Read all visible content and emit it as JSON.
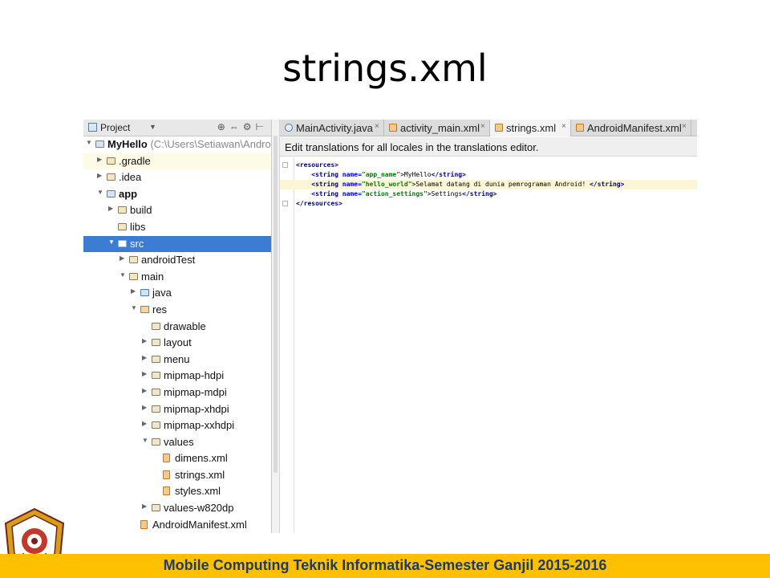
{
  "slide": {
    "title": "strings.xml",
    "footer": "Mobile Computing Teknik Informatika-Semester Ganjil 2015-2016"
  },
  "project_panel": {
    "header_label": "Project",
    "tree": [
      {
        "label": "MyHello",
        "path": " (C:\\Users\\Setiawan\\Android",
        "bold": true,
        "indent": 0,
        "arrow": "down",
        "icon": "module",
        "highlight": "none"
      },
      {
        "label": ".gradle",
        "indent": 1,
        "arrow": "right",
        "icon": "folder",
        "highlight": "yellow"
      },
      {
        "label": ".idea",
        "indent": 1,
        "arrow": "right",
        "icon": "folder",
        "highlight": "none"
      },
      {
        "label": "app",
        "bold": true,
        "indent": 1,
        "arrow": "down",
        "icon": "module",
        "highlight": "none"
      },
      {
        "label": "build",
        "indent": 2,
        "arrow": "right",
        "icon": "folder",
        "highlight": "none"
      },
      {
        "label": "libs",
        "indent": 2,
        "arrow": "none",
        "icon": "folder",
        "highlight": "none"
      },
      {
        "label": "src",
        "indent": 2,
        "arrow": "down",
        "icon": "src-folder",
        "highlight": "selected"
      },
      {
        "label": "androidTest",
        "indent": 3,
        "arrow": "right",
        "icon": "folder",
        "highlight": "none"
      },
      {
        "label": "main",
        "indent": 3,
        "arrow": "down",
        "icon": "folder",
        "highlight": "none"
      },
      {
        "label": "java",
        "indent": 4,
        "arrow": "right",
        "icon": "java-folder",
        "highlight": "none"
      },
      {
        "label": "res",
        "indent": 4,
        "arrow": "down",
        "icon": "res-folder",
        "highlight": "none"
      },
      {
        "label": "drawable",
        "indent": 5,
        "arrow": "none",
        "icon": "sub-folder",
        "highlight": "none"
      },
      {
        "label": "layout",
        "indent": 5,
        "arrow": "right",
        "icon": "sub-folder",
        "highlight": "none"
      },
      {
        "label": "menu",
        "indent": 5,
        "arrow": "right",
        "icon": "sub-folder",
        "highlight": "none"
      },
      {
        "label": "mipmap-hdpi",
        "indent": 5,
        "arrow": "right",
        "icon": "sub-folder",
        "highlight": "none"
      },
      {
        "label": "mipmap-mdpi",
        "indent": 5,
        "arrow": "right",
        "icon": "sub-folder",
        "highlight": "none"
      },
      {
        "label": "mipmap-xhdpi",
        "indent": 5,
        "arrow": "right",
        "icon": "sub-folder",
        "highlight": "none"
      },
      {
        "label": "mipmap-xxhdpi",
        "indent": 5,
        "arrow": "right",
        "icon": "sub-folder",
        "highlight": "none"
      },
      {
        "label": "values",
        "indent": 5,
        "arrow": "down",
        "icon": "sub-folder",
        "highlight": "none"
      },
      {
        "label": "dimens.xml",
        "indent": 6,
        "arrow": "none",
        "icon": "xml-file",
        "highlight": "none"
      },
      {
        "label": "strings.xml",
        "indent": 6,
        "arrow": "none",
        "icon": "xml-file",
        "highlight": "none"
      },
      {
        "label": "styles.xml",
        "indent": 6,
        "arrow": "none",
        "icon": "xml-file",
        "highlight": "none"
      },
      {
        "label": "values-w820dp",
        "indent": 5,
        "arrow": "right",
        "icon": "sub-folder",
        "highlight": "none"
      },
      {
        "label": "AndroidManifest.xml",
        "indent": 4,
        "arrow": "none",
        "icon": "xml-file",
        "highlight": "none"
      }
    ]
  },
  "editor": {
    "tabs": [
      {
        "label": "MainActivity.java",
        "icon": "class-icon",
        "active": false
      },
      {
        "label": "activity_main.xml",
        "icon": "xml-file-icon",
        "active": false
      },
      {
        "label": "strings.xml",
        "icon": "xml-file-icon",
        "active": true
      },
      {
        "label": "AndroidManifest.xml",
        "icon": "xml-file-icon",
        "active": false
      }
    ],
    "close_glyph": "×",
    "notice": "Edit translations for all locales in the translations editor.",
    "code": [
      {
        "indent": "",
        "open": "<resources>",
        "attr": "",
        "val": "",
        "text": "",
        "close": "",
        "fold": true,
        "caret": false
      },
      {
        "indent": "    ",
        "open": "<string ",
        "attr": "name=",
        "val": "\"app_name\"",
        "text": ">MyHello",
        "close": "</string>",
        "fold": false,
        "caret": false
      },
      {
        "indent": "    ",
        "open": "<string ",
        "attr": "name=",
        "val": "\"hello_world\"",
        "text": ">Selamat datang di dunia pemrograman Android! ",
        "close": "</string>",
        "fold": false,
        "caret": true
      },
      {
        "indent": "    ",
        "open": "<string ",
        "attr": "name=",
        "val": "\"action_settings\"",
        "text": ">Settings",
        "close": "</string>",
        "fold": false,
        "caret": false
      },
      {
        "indent": "",
        "open": "</resources>",
        "attr": "",
        "val": "",
        "text": "",
        "close": "",
        "fold": true,
        "caret": false
      }
    ]
  },
  "colors": {
    "footer_bg": "#ffc000",
    "footer_text": "#1f3a5f",
    "selection": "#3c7dd3"
  }
}
